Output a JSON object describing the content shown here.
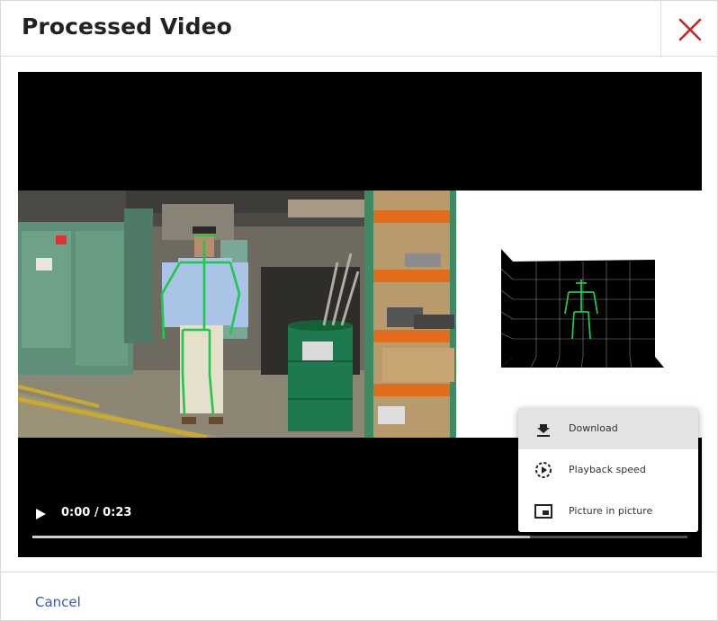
{
  "dialog": {
    "title": "Processed Video",
    "close_icon": "close-x-icon",
    "close_color": "#c62828"
  },
  "player": {
    "time_display": "0:00 / 0:23",
    "progress_fraction": 0.76,
    "play_icon": "play-icon",
    "menu": {
      "items": [
        {
          "label": "Download",
          "icon": "download-icon",
          "highlighted": true
        },
        {
          "label": "Playback speed",
          "icon": "playback-speed-icon",
          "highlighted": false
        },
        {
          "label": "Picture in picture",
          "icon": "picture-in-picture-icon",
          "highlighted": false
        }
      ]
    },
    "skeleton_color": "#1ec84a"
  },
  "footer": {
    "cancel_label": "Cancel",
    "cancel_color": "#3a55b4"
  }
}
